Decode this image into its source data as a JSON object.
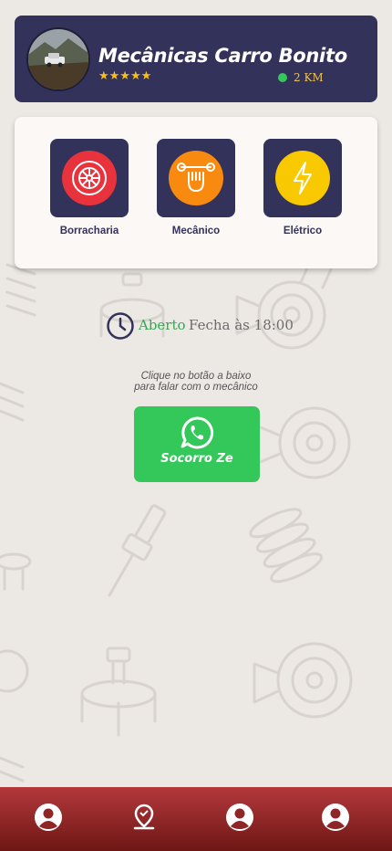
{
  "header": {
    "shop_name": "Mecânicas Carro Bonito",
    "rating_stars": "★★★★★",
    "distance": "2 KM",
    "avatar_icon": "car-photo"
  },
  "categories": [
    {
      "label": "Borracharia",
      "icon": "tire-icon",
      "color": "#e8323c"
    },
    {
      "label": "Mecânico",
      "icon": "wrench-fist-icon",
      "color": "#f88a0f"
    },
    {
      "label": "Elétrico",
      "icon": "lightning-icon",
      "color": "#f8c900"
    }
  ],
  "status": {
    "open_label": "Aberto",
    "closes_label": "Fecha às 18:00"
  },
  "hint": {
    "line1": "Clique no botão a baixo",
    "line2": "para falar com o mecânico"
  },
  "whatsapp_button": {
    "label": "Socorro Ze"
  },
  "bottom_nav": [
    {
      "icon": "user-icon"
    },
    {
      "icon": "location-pin-icon"
    },
    {
      "icon": "user-icon"
    },
    {
      "icon": "user-icon"
    }
  ],
  "colors": {
    "primary": "#33325b",
    "accent_green": "#34c759",
    "nav_red": "#b4383c",
    "background": "#ece8e4"
  }
}
